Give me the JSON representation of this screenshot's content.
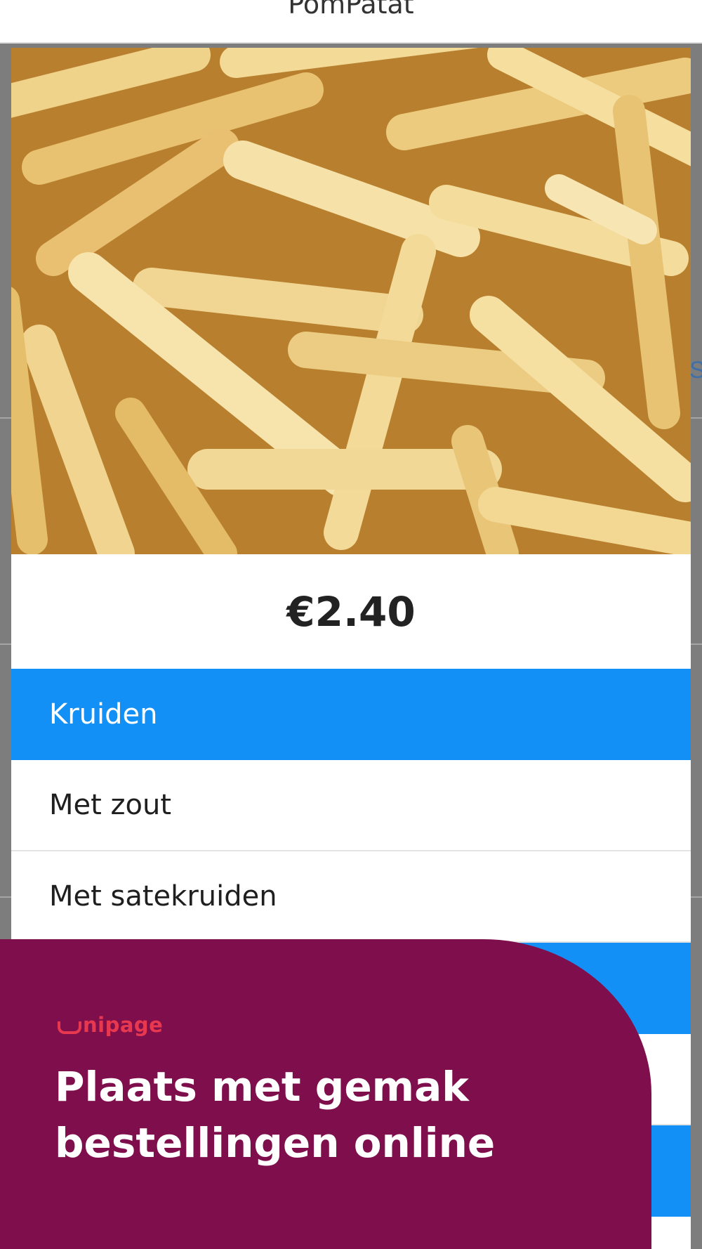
{
  "topbar": {
    "title": "PomPatat"
  },
  "background": {
    "peek_text": "S"
  },
  "product": {
    "image_label": "french-fries-photo",
    "price": "€2.40"
  },
  "options": {
    "group_header": "Kruiden",
    "items": [
      {
        "label": "Met zout"
      },
      {
        "label": "Met satekruiden"
      }
    ]
  },
  "promo": {
    "brand": "nipage",
    "headline_line1": "Plaats met gemak",
    "headline_line2": "bestellingen online"
  },
  "colors": {
    "accent_blue": "#1390f5",
    "promo_bg": "#7f0f4c",
    "brand_red": "#e8384f"
  }
}
